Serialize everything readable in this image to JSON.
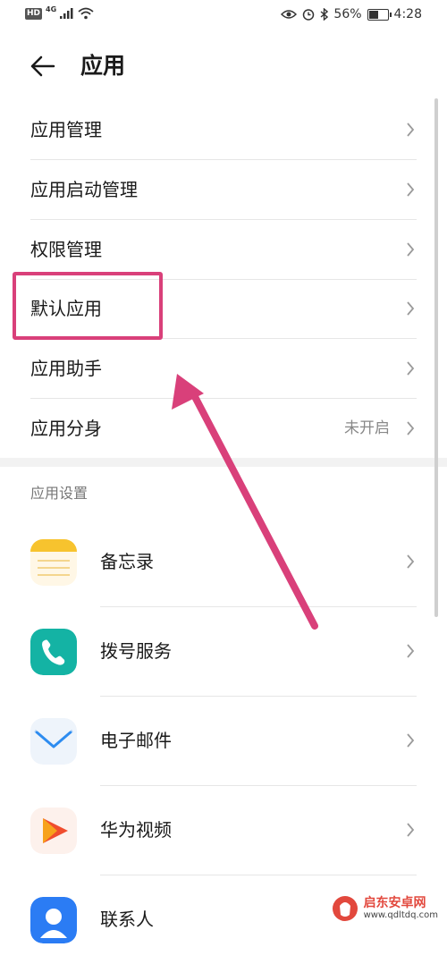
{
  "status_bar": {
    "hd": "HD",
    "network": "4G",
    "battery": "56%",
    "battery_level": 0.56,
    "time": "4:28",
    "icons": [
      "signal-icon",
      "wifi-icon",
      "eye-icon",
      "alarm-icon",
      "bluetooth-icon",
      "battery-icon"
    ]
  },
  "header": {
    "title": "应用",
    "back_icon": "arrow-left-icon"
  },
  "menu": [
    {
      "label": "应用管理",
      "value": ""
    },
    {
      "label": "应用启动管理",
      "value": ""
    },
    {
      "label": "权限管理",
      "value": ""
    },
    {
      "label": "默认应用",
      "value": ""
    },
    {
      "label": "应用助手",
      "value": ""
    },
    {
      "label": "应用分身",
      "value": "未开启"
    }
  ],
  "section": {
    "title": "应用设置"
  },
  "apps": [
    {
      "label": "备忘录",
      "icon": "notepad-icon",
      "color": "#f7c32e"
    },
    {
      "label": "拨号服务",
      "icon": "phone-icon",
      "color": "#14b3a4"
    },
    {
      "label": "电子邮件",
      "icon": "mail-icon",
      "color": "#2d8cf0"
    },
    {
      "label": "华为视频",
      "icon": "video-play-icon",
      "color": "#f04d2e"
    },
    {
      "label": "联系人",
      "icon": "contacts-icon",
      "color": "#2b7cf4"
    }
  ],
  "annotation": {
    "color": "#d9407a"
  },
  "watermark": {
    "name": "启东安卓网",
    "url": "www.qdltdq.com"
  }
}
